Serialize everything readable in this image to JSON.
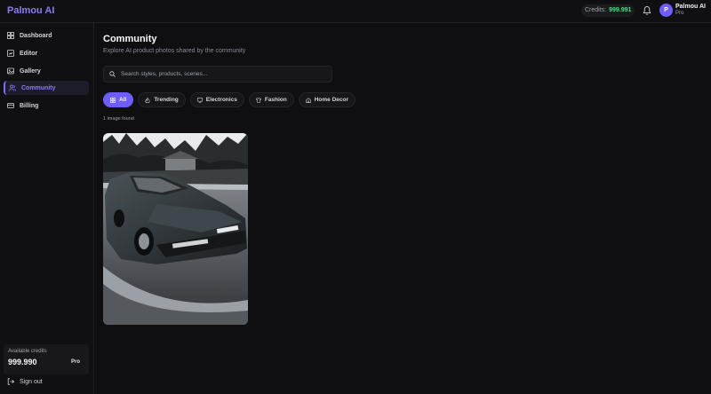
{
  "app": {
    "brand": "Palmou AI"
  },
  "header": {
    "credits_label": "Credits:",
    "credits_value": "999.991",
    "user": {
      "initial": "P",
      "name": "Palmou AI",
      "plan": "Pro"
    }
  },
  "sidebar": {
    "items": [
      {
        "label": "Dashboard",
        "icon": "dashboard-icon",
        "active": false
      },
      {
        "label": "Editor",
        "icon": "editor-icon",
        "active": false
      },
      {
        "label": "Gallery",
        "icon": "gallery-icon",
        "active": false
      },
      {
        "label": "Community",
        "icon": "users-icon",
        "active": true
      },
      {
        "label": "Billing",
        "icon": "card-icon",
        "active": false
      }
    ],
    "credits_card": {
      "label": "Available credits",
      "value": "999.990",
      "plan": "Pro"
    },
    "signout_label": "Sign out"
  },
  "main": {
    "title": "Community",
    "subtitle": "Explore AI product photos shared by the community",
    "search": {
      "placeholder": "Search styles, products, scenes...",
      "value": ""
    },
    "filters": [
      {
        "label": "All",
        "icon": "grid-icon",
        "active": true
      },
      {
        "label": "Trending",
        "icon": "flame-icon",
        "active": false
      },
      {
        "label": "Electronics",
        "icon": "monitor-icon",
        "active": false
      },
      {
        "label": "Fashion",
        "icon": "shirt-icon",
        "active": false
      },
      {
        "label": "Home Decor",
        "icon": "home-icon",
        "active": false
      }
    ],
    "result_count": "1 image found"
  },
  "colors": {
    "accent": "#6d5dfc",
    "accent_text": "#8b7cf6",
    "credits_green": "#4ade80",
    "background": "#0f0f12"
  }
}
